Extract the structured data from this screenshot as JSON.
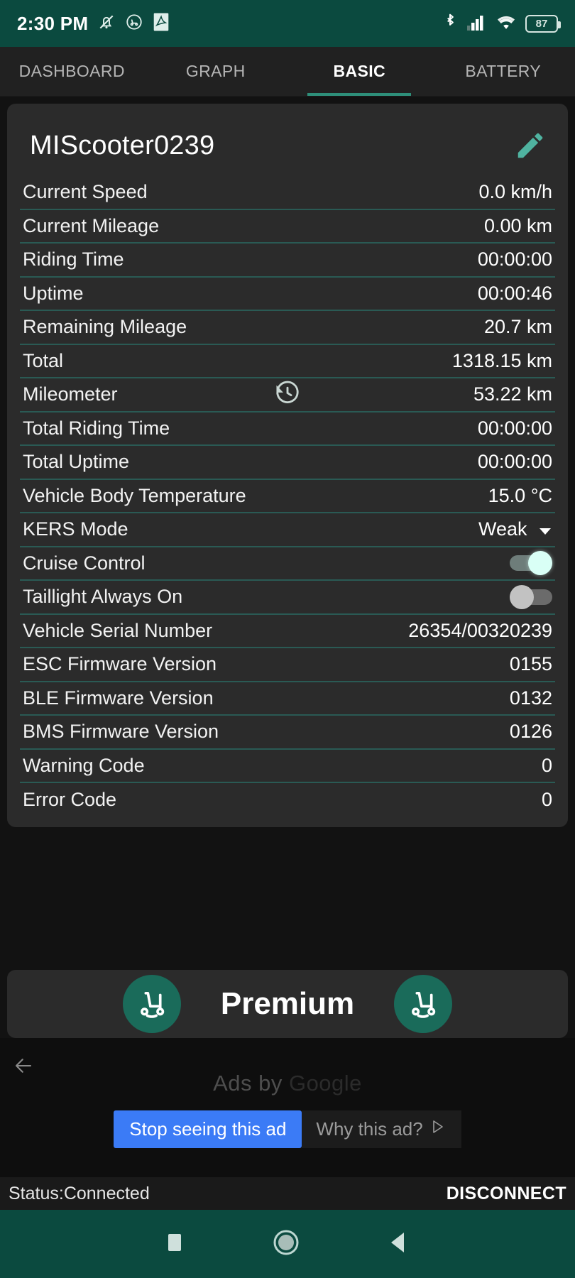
{
  "status_bar": {
    "clock": "2:30 PM",
    "left_icons": [
      "bell-muted-icon",
      "scooter-face-icon",
      "pdf-icon"
    ],
    "right_icons": [
      "bluetooth-icon",
      "cellular-signal-icon",
      "wifi-icon"
    ],
    "battery_percent": "87"
  },
  "tabs": [
    {
      "label": "DASHBOARD",
      "active": false
    },
    {
      "label": "GRAPH",
      "active": false
    },
    {
      "label": "BASIC",
      "active": true
    },
    {
      "label": "BATTERY",
      "active": false
    }
  ],
  "card": {
    "device_name": "MIScooter0239",
    "edit_icon": "pencil-icon",
    "rows": [
      {
        "label": "Current Speed",
        "value": "0.0 km/h"
      },
      {
        "label": "Current Mileage",
        "value": "0.00 km"
      },
      {
        "label": "Riding Time",
        "value": "00:00:00"
      },
      {
        "label": "Uptime",
        "value": "00:00:46"
      },
      {
        "label": "Remaining Mileage",
        "value": "20.7 km"
      },
      {
        "label": "Total",
        "value": "1318.15 km"
      },
      {
        "label": "Mileometer",
        "value": "53.22 km",
        "mid_icon": "history-icon"
      },
      {
        "label": "Total Riding Time",
        "value": "00:00:00"
      },
      {
        "label": "Total Uptime",
        "value": "00:00:00"
      },
      {
        "label": "Vehicle Body Temperature",
        "value": "15.0 °C"
      },
      {
        "label": "KERS Mode",
        "value": "Weak",
        "type": "dropdown"
      },
      {
        "label": "Cruise Control",
        "value": "",
        "type": "toggle",
        "on": true
      },
      {
        "label": "Taillight Always On",
        "value": "",
        "type": "toggle",
        "on": false
      },
      {
        "label": "Vehicle Serial Number",
        "value": "26354/00320239"
      },
      {
        "label": "ESC Firmware Version",
        "value": "0155"
      },
      {
        "label": "BLE Firmware Version",
        "value": "0132"
      },
      {
        "label": "BMS Firmware Version",
        "value": "0126"
      },
      {
        "label": "Warning Code",
        "value": "0"
      },
      {
        "label": "Error Code",
        "value": "0"
      }
    ]
  },
  "premium": {
    "label": "Premium",
    "left_icon": "scooter-icon",
    "right_icon": "scooter-icon"
  },
  "ad": {
    "back_icon": "arrow-left-icon",
    "ads_by_prefix": "Ads by ",
    "ads_by_brand": "Google",
    "stop_label": "Stop seeing this ad",
    "why_label": "Why this ad?",
    "why_icon": "adchoices-icon"
  },
  "connection": {
    "status": "Status:Connected",
    "disconnect_label": "DISCONNECT"
  },
  "nav_bar": {
    "recents_icon": "square-icon",
    "home_icon": "circle-icon",
    "back_icon": "triangle-left-icon"
  },
  "colors": {
    "accent_teal": "#0b4a3f",
    "tab_indicator": "#2e8f7a",
    "divider": "#2a5a54",
    "card_bg": "#2b2b2b",
    "ad_button_blue": "#3b7bf6",
    "toggle_on": "#d9fff6"
  }
}
